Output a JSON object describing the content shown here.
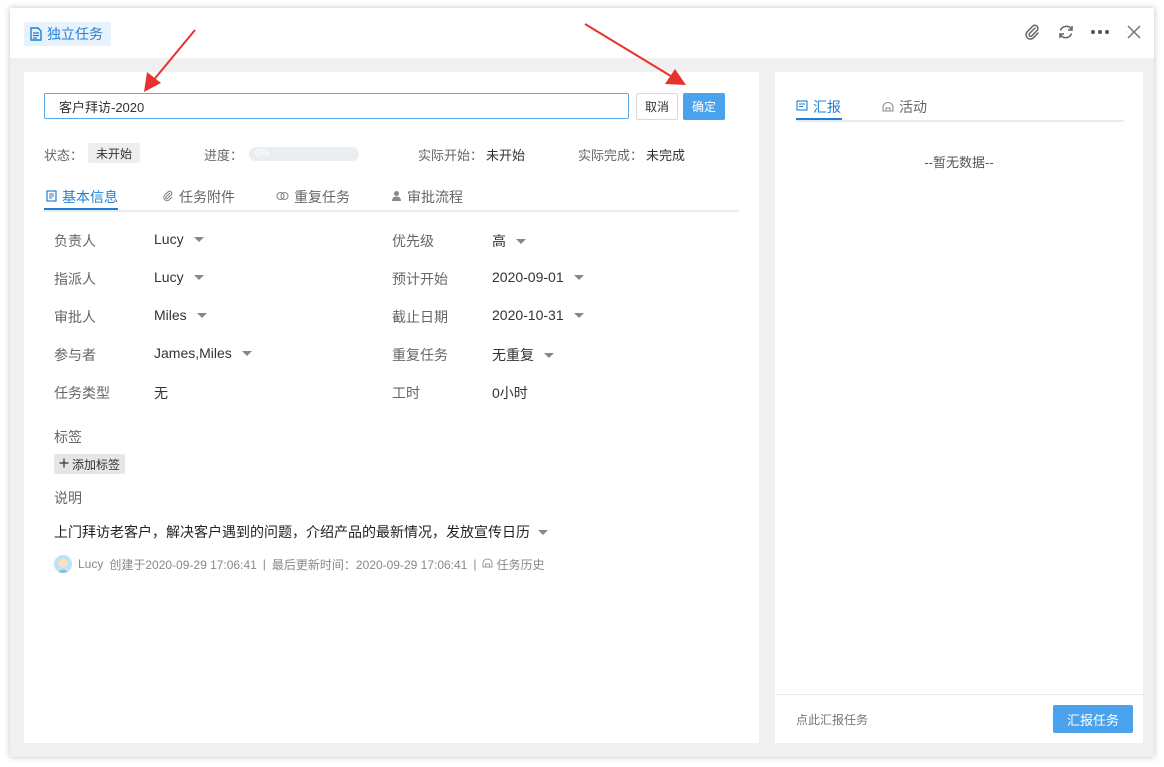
{
  "window": {
    "title": "独立任务"
  },
  "toolbar": {
    "attach_icon": "paperclip-icon",
    "refresh_icon": "refresh-icon",
    "more_icon": "more-dots-icon",
    "close_icon": "close-icon"
  },
  "task": {
    "name": "客户拜访-2020",
    "cancel_label": "取消",
    "confirm_label": "确定"
  },
  "status": {
    "status_label": "状态：",
    "status_value": "未开始",
    "progress_label": "进度：",
    "progress_value": "0%",
    "progress_fraction": 0,
    "actual_start_label": "实际开始：",
    "actual_start_value": "未开始",
    "actual_finish_label": "实际完成：",
    "actual_finish_value": "未完成"
  },
  "tabs": [
    {
      "label": "基本信息",
      "icon": "document-icon",
      "active": true
    },
    {
      "label": "任务附件",
      "icon": "paperclip-icon",
      "active": false
    },
    {
      "label": "重复任务",
      "icon": "repeat-icon",
      "active": false
    },
    {
      "label": "审批流程",
      "icon": "person-icon",
      "active": false
    }
  ],
  "fields": {
    "owner": {
      "label": "负责人",
      "value": "Lucy"
    },
    "assigner": {
      "label": "指派人",
      "value": "Lucy"
    },
    "approver": {
      "label": "审批人",
      "value": "Miles"
    },
    "participants": {
      "label": "参与者",
      "value": "James,Miles"
    },
    "task_type": {
      "label": "任务类型",
      "value": "无"
    },
    "priority": {
      "label": "优先级",
      "value": "高"
    },
    "planned_start": {
      "label": "预计开始",
      "value": "2020-09-01"
    },
    "due_date": {
      "label": "截止日期",
      "value": "2020-10-31"
    },
    "repeat": {
      "label": "重复任务",
      "value": "无重复"
    },
    "work_hours": {
      "label": "工时",
      "value": "0小时"
    }
  },
  "tags": {
    "label": "标签",
    "add_label": "添加标签"
  },
  "description": {
    "label": "说明",
    "text": "上门拜访老客户，解决客户遇到的问题，介绍产品的最新情况，发放宣传日历"
  },
  "meta": {
    "user": "Lucy",
    "created": "创建于2020-09-29 17:06:41",
    "sep1": "|",
    "updated": "最后更新时间：2020-09-29 17:06:41",
    "sep2": "|",
    "history": "任务历史"
  },
  "right_panel": {
    "tabs": [
      {
        "label": "汇报",
        "icon": "report-icon",
        "active": true
      },
      {
        "label": "活动",
        "icon": "activity-icon",
        "active": false
      }
    ],
    "empty_text": "--暂无数据--",
    "footer_text": "点此汇报任务",
    "report_button": "汇报任务"
  },
  "colors": {
    "accent": "#1f7fd6",
    "button_primary": "#4aa2ec",
    "annotation_arrow": "#e8322e"
  }
}
